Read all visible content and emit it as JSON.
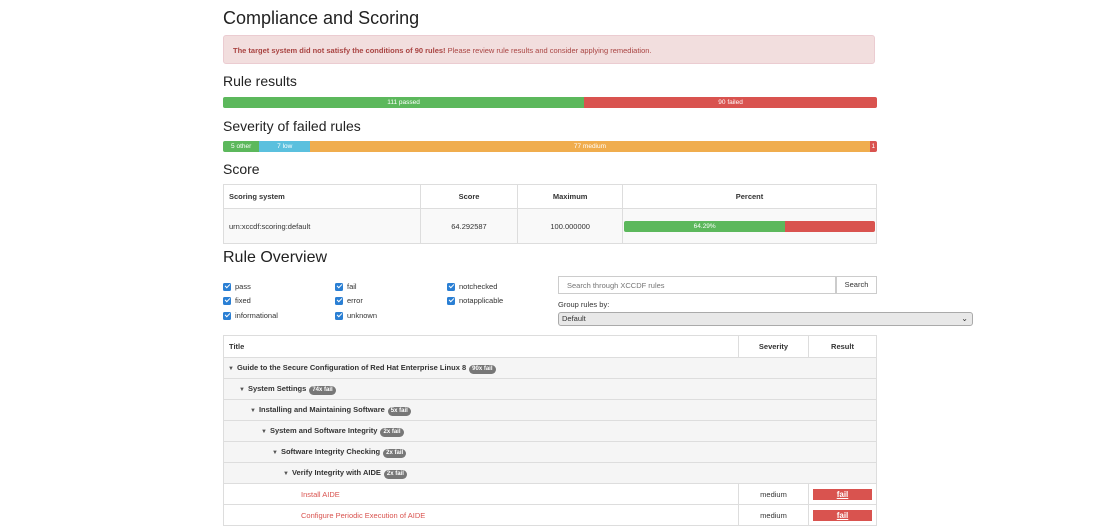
{
  "compliance": {
    "title": "Compliance and Scoring",
    "alert_bold": "The target system did not satisfy the conditions of 90 rules!",
    "alert_text": " Please review rule results and consider applying remediation."
  },
  "rule_results": {
    "title": "Rule results",
    "passed_label": "111 passed",
    "failed_label": "90 failed",
    "passed": 111,
    "failed": 90
  },
  "severity": {
    "title": "Severity of failed rules",
    "segments": [
      {
        "label": "5 other",
        "value": 5,
        "color": "#5cb85c"
      },
      {
        "label": "7 low",
        "value": 7,
        "color": "#5bc0de"
      },
      {
        "label": "77 medium",
        "value": 77,
        "color": "#f0ad4e"
      },
      {
        "label": "1",
        "value": 1,
        "color": "#d9534f"
      }
    ]
  },
  "score": {
    "title": "Score",
    "headers": [
      "Scoring system",
      "Score",
      "Maximum",
      "Percent"
    ],
    "row": {
      "system": "urn:xccdf:scoring:default",
      "score": "64.292587",
      "maximum": "100.000000",
      "percent_label": "64.29%",
      "percent": 64.29
    }
  },
  "overview": {
    "title": "Rule Overview",
    "filters": [
      {
        "label": "pass",
        "checked": true
      },
      {
        "label": "fixed",
        "checked": true
      },
      {
        "label": "informational",
        "checked": true
      },
      {
        "label": "fail",
        "checked": true
      },
      {
        "label": "error",
        "checked": true
      },
      {
        "label": "unknown",
        "checked": true
      },
      {
        "label": "notchecked",
        "checked": true
      },
      {
        "label": "notapplicable",
        "checked": true
      }
    ],
    "search_placeholder": "Search through XCCDF rules",
    "search_button": "Search",
    "group_label": "Group rules by:",
    "group_value": "Default",
    "table_headers": {
      "title": "Title",
      "severity": "Severity",
      "result": "Result"
    },
    "groups": [
      {
        "label": "Guide to the Secure Configuration of Red Hat Enterprise Linux 8",
        "badge": "90x fail"
      },
      {
        "label": "System Settings",
        "badge": "74x fail"
      },
      {
        "label": "Installing and Maintaining Software",
        "badge": "5x fail"
      },
      {
        "label": "System and Software Integrity",
        "badge": "2x fail"
      },
      {
        "label": "Software Integrity Checking",
        "badge": "2x fail"
      },
      {
        "label": "Verify Integrity with AIDE",
        "badge": "2x fail"
      }
    ],
    "rules": [
      {
        "title": "Install AIDE",
        "severity": "medium",
        "result": "fail"
      },
      {
        "title": "Configure Periodic Execution of AIDE",
        "severity": "medium",
        "result": "fail"
      }
    ]
  }
}
